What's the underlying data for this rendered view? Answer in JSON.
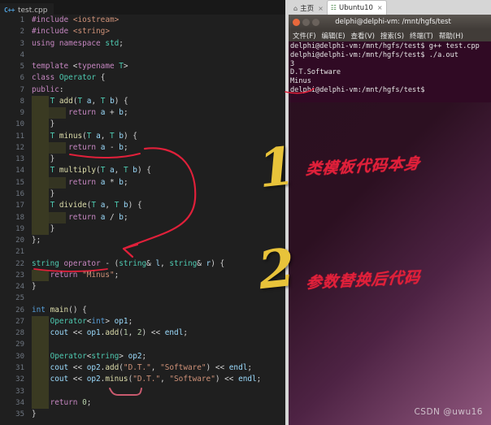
{
  "editor": {
    "tab": {
      "icon": "cpp-file-icon",
      "label": "test.cpp"
    },
    "lines": [
      {
        "n": "1",
        "indent": 0,
        "tokens": [
          {
            "t": "#include ",
            "c": "k"
          },
          {
            "t": "<iostream>",
            "c": "str"
          }
        ]
      },
      {
        "n": "2",
        "indent": 0,
        "tokens": [
          {
            "t": "#include ",
            "c": "k"
          },
          {
            "t": "<string>",
            "c": "str"
          }
        ]
      },
      {
        "n": "3",
        "indent": 0,
        "tokens": [
          {
            "t": "using",
            "c": "k"
          },
          {
            "t": " ",
            "c": "pl"
          },
          {
            "t": "namespace",
            "c": "k"
          },
          {
            "t": " ",
            "c": "pl"
          },
          {
            "t": "std",
            "c": "ty"
          },
          {
            "t": ";",
            "c": "pl"
          }
        ]
      },
      {
        "n": "4",
        "indent": 0,
        "tokens": []
      },
      {
        "n": "5",
        "indent": 0,
        "tokens": [
          {
            "t": "template",
            "c": "k"
          },
          {
            "t": " <",
            "c": "pl"
          },
          {
            "t": "typename",
            "c": "k"
          },
          {
            "t": " ",
            "c": "pl"
          },
          {
            "t": "T",
            "c": "ty"
          },
          {
            "t": ">",
            "c": "pl"
          }
        ]
      },
      {
        "n": "6",
        "indent": 0,
        "tokens": [
          {
            "t": "class",
            "c": "k"
          },
          {
            "t": " ",
            "c": "pl"
          },
          {
            "t": "Operator",
            "c": "cls"
          },
          {
            "t": " {",
            "c": "pl"
          }
        ]
      },
      {
        "n": "7",
        "indent": 0,
        "tokens": [
          {
            "t": "public",
            "c": "k"
          },
          {
            "t": ":",
            "c": "pl"
          }
        ]
      },
      {
        "n": "8",
        "indent": 1,
        "tokens": [
          {
            "t": "T",
            "c": "ty"
          },
          {
            "t": " ",
            "c": "pl"
          },
          {
            "t": "add",
            "c": "fn"
          },
          {
            "t": "(",
            "c": "pl"
          },
          {
            "t": "T",
            "c": "ty"
          },
          {
            "t": " ",
            "c": "pl"
          },
          {
            "t": "a",
            "c": "var"
          },
          {
            "t": ", ",
            "c": "pl"
          },
          {
            "t": "T",
            "c": "ty"
          },
          {
            "t": " ",
            "c": "pl"
          },
          {
            "t": "b",
            "c": "var"
          },
          {
            "t": ") {",
            "c": "pl"
          }
        ]
      },
      {
        "n": "9",
        "indent": 2,
        "tokens": [
          {
            "t": "return",
            "c": "k"
          },
          {
            "t": " ",
            "c": "pl"
          },
          {
            "t": "a",
            "c": "var"
          },
          {
            "t": " + ",
            "c": "pl"
          },
          {
            "t": "b",
            "c": "var"
          },
          {
            "t": ";",
            "c": "pl"
          }
        ]
      },
      {
        "n": "10",
        "indent": 1,
        "tokens": [
          {
            "t": "}",
            "c": "pl"
          }
        ]
      },
      {
        "n": "11",
        "indent": 1,
        "tokens": [
          {
            "t": "T",
            "c": "ty"
          },
          {
            "t": " ",
            "c": "pl"
          },
          {
            "t": "minus",
            "c": "fn"
          },
          {
            "t": "(",
            "c": "pl"
          },
          {
            "t": "T",
            "c": "ty"
          },
          {
            "t": " ",
            "c": "pl"
          },
          {
            "t": "a",
            "c": "var"
          },
          {
            "t": ", ",
            "c": "pl"
          },
          {
            "t": "T",
            "c": "ty"
          },
          {
            "t": " ",
            "c": "pl"
          },
          {
            "t": "b",
            "c": "var"
          },
          {
            "t": ") {",
            "c": "pl"
          }
        ]
      },
      {
        "n": "12",
        "indent": 2,
        "tokens": [
          {
            "t": "return",
            "c": "k"
          },
          {
            "t": " ",
            "c": "pl"
          },
          {
            "t": "a",
            "c": "var"
          },
          {
            "t": " - ",
            "c": "pl"
          },
          {
            "t": "b",
            "c": "var"
          },
          {
            "t": ";",
            "c": "pl"
          }
        ]
      },
      {
        "n": "13",
        "indent": 1,
        "tokens": [
          {
            "t": "}",
            "c": "pl"
          }
        ]
      },
      {
        "n": "14",
        "indent": 1,
        "tokens": [
          {
            "t": "T",
            "c": "ty"
          },
          {
            "t": " ",
            "c": "pl"
          },
          {
            "t": "multiply",
            "c": "fn"
          },
          {
            "t": "(",
            "c": "pl"
          },
          {
            "t": "T",
            "c": "ty"
          },
          {
            "t": " ",
            "c": "pl"
          },
          {
            "t": "a",
            "c": "var"
          },
          {
            "t": ", ",
            "c": "pl"
          },
          {
            "t": "T",
            "c": "ty"
          },
          {
            "t": " ",
            "c": "pl"
          },
          {
            "t": "b",
            "c": "var"
          },
          {
            "t": ") {",
            "c": "pl"
          }
        ]
      },
      {
        "n": "15",
        "indent": 2,
        "tokens": [
          {
            "t": "return",
            "c": "k"
          },
          {
            "t": " ",
            "c": "pl"
          },
          {
            "t": "a",
            "c": "var"
          },
          {
            "t": " * ",
            "c": "pl"
          },
          {
            "t": "b",
            "c": "var"
          },
          {
            "t": ";",
            "c": "pl"
          }
        ]
      },
      {
        "n": "16",
        "indent": 1,
        "tokens": [
          {
            "t": "}",
            "c": "pl"
          }
        ]
      },
      {
        "n": "17",
        "indent": 1,
        "tokens": [
          {
            "t": "T",
            "c": "ty"
          },
          {
            "t": " ",
            "c": "pl"
          },
          {
            "t": "divide",
            "c": "fn"
          },
          {
            "t": "(",
            "c": "pl"
          },
          {
            "t": "T",
            "c": "ty"
          },
          {
            "t": " ",
            "c": "pl"
          },
          {
            "t": "a",
            "c": "var"
          },
          {
            "t": ", ",
            "c": "pl"
          },
          {
            "t": "T",
            "c": "ty"
          },
          {
            "t": " ",
            "c": "pl"
          },
          {
            "t": "b",
            "c": "var"
          },
          {
            "t": ") {",
            "c": "pl"
          }
        ]
      },
      {
        "n": "18",
        "indent": 2,
        "tokens": [
          {
            "t": "return",
            "c": "k"
          },
          {
            "t": " ",
            "c": "pl"
          },
          {
            "t": "a",
            "c": "var"
          },
          {
            "t": " / ",
            "c": "pl"
          },
          {
            "t": "b",
            "c": "var"
          },
          {
            "t": ";",
            "c": "pl"
          }
        ]
      },
      {
        "n": "19",
        "indent": 1,
        "tokens": [
          {
            "t": "}",
            "c": "pl"
          }
        ]
      },
      {
        "n": "20",
        "indent": 0,
        "tokens": [
          {
            "t": "};",
            "c": "pl"
          }
        ]
      },
      {
        "n": "21",
        "indent": 0,
        "tokens": []
      },
      {
        "n": "22",
        "indent": 0,
        "tokens": [
          {
            "t": "string",
            "c": "ty"
          },
          {
            "t": " ",
            "c": "pl"
          },
          {
            "t": "operator",
            "c": "k"
          },
          {
            "t": " - (",
            "c": "pl"
          },
          {
            "t": "string",
            "c": "ty"
          },
          {
            "t": "& ",
            "c": "pl"
          },
          {
            "t": "l",
            "c": "var"
          },
          {
            "t": ", ",
            "c": "pl"
          },
          {
            "t": "string",
            "c": "ty"
          },
          {
            "t": "& ",
            "c": "pl"
          },
          {
            "t": "r",
            "c": "var"
          },
          {
            "t": ") {",
            "c": "pl"
          }
        ]
      },
      {
        "n": "23",
        "indent": 1,
        "tokens": [
          {
            "t": "return",
            "c": "k"
          },
          {
            "t": " ",
            "c": "pl"
          },
          {
            "t": "\"Minus\"",
            "c": "str"
          },
          {
            "t": ";",
            "c": "pl"
          }
        ]
      },
      {
        "n": "24",
        "indent": 0,
        "tokens": [
          {
            "t": "}",
            "c": "pl"
          }
        ]
      },
      {
        "n": "25",
        "indent": 0,
        "tokens": []
      },
      {
        "n": "26",
        "indent": 0,
        "tokens": [
          {
            "t": "int",
            "c": "kb"
          },
          {
            "t": " ",
            "c": "pl"
          },
          {
            "t": "main",
            "c": "fn"
          },
          {
            "t": "() {",
            "c": "pl"
          }
        ]
      },
      {
        "n": "27",
        "indent": 1,
        "tokens": [
          {
            "t": "Operator",
            "c": "cls"
          },
          {
            "t": "<",
            "c": "pl"
          },
          {
            "t": "int",
            "c": "kb"
          },
          {
            "t": "> ",
            "c": "pl"
          },
          {
            "t": "op1",
            "c": "var"
          },
          {
            "t": ";",
            "c": "pl"
          }
        ]
      },
      {
        "n": "28",
        "indent": 1,
        "tokens": [
          {
            "t": "cout",
            "c": "var"
          },
          {
            "t": " << ",
            "c": "pl"
          },
          {
            "t": "op1",
            "c": "var"
          },
          {
            "t": ".",
            "c": "pl"
          },
          {
            "t": "add",
            "c": "fn"
          },
          {
            "t": "(",
            "c": "pl"
          },
          {
            "t": "1",
            "c": "num"
          },
          {
            "t": ", ",
            "c": "pl"
          },
          {
            "t": "2",
            "c": "num"
          },
          {
            "t": ") << ",
            "c": "pl"
          },
          {
            "t": "endl",
            "c": "var"
          },
          {
            "t": ";",
            "c": "pl"
          }
        ]
      },
      {
        "n": "29",
        "indent": 1,
        "tokens": []
      },
      {
        "n": "30",
        "indent": 1,
        "tokens": [
          {
            "t": "Operator",
            "c": "cls"
          },
          {
            "t": "<",
            "c": "pl"
          },
          {
            "t": "string",
            "c": "ty"
          },
          {
            "t": "> ",
            "c": "pl"
          },
          {
            "t": "op2",
            "c": "var"
          },
          {
            "t": ";",
            "c": "pl"
          }
        ]
      },
      {
        "n": "31",
        "indent": 1,
        "tokens": [
          {
            "t": "cout",
            "c": "var"
          },
          {
            "t": " << ",
            "c": "pl"
          },
          {
            "t": "op2",
            "c": "var"
          },
          {
            "t": ".",
            "c": "pl"
          },
          {
            "t": "add",
            "c": "fn"
          },
          {
            "t": "(",
            "c": "pl"
          },
          {
            "t": "\"D.T.\"",
            "c": "str"
          },
          {
            "t": ", ",
            "c": "pl"
          },
          {
            "t": "\"Software\"",
            "c": "str"
          },
          {
            "t": ") << ",
            "c": "pl"
          },
          {
            "t": "endl",
            "c": "var"
          },
          {
            "t": ";",
            "c": "pl"
          }
        ]
      },
      {
        "n": "32",
        "indent": 1,
        "tokens": [
          {
            "t": "cout",
            "c": "var"
          },
          {
            "t": " << ",
            "c": "pl"
          },
          {
            "t": "op2",
            "c": "var"
          },
          {
            "t": ".",
            "c": "pl"
          },
          {
            "t": "minus",
            "c": "fn"
          },
          {
            "t": "(",
            "c": "pl"
          },
          {
            "t": "\"D.T.\"",
            "c": "str"
          },
          {
            "t": ", ",
            "c": "pl"
          },
          {
            "t": "\"Software\"",
            "c": "str"
          },
          {
            "t": ") << ",
            "c": "pl"
          },
          {
            "t": "endl",
            "c": "var"
          },
          {
            "t": ";",
            "c": "pl"
          }
        ]
      },
      {
        "n": "33",
        "indent": 1,
        "tokens": []
      },
      {
        "n": "34",
        "indent": 1,
        "tokens": [
          {
            "t": "return",
            "c": "k"
          },
          {
            "t": " ",
            "c": "pl"
          },
          {
            "t": "0",
            "c": "num"
          },
          {
            "t": ";",
            "c": "pl"
          }
        ]
      },
      {
        "n": "35",
        "indent": 0,
        "tokens": [
          {
            "t": "}",
            "c": "pl"
          }
        ]
      }
    ]
  },
  "browser": {
    "tabs": [
      {
        "icon": "home-icon",
        "label": "主页",
        "close": "×",
        "active": false
      },
      {
        "icon": "ubuntu-vm-icon",
        "label": "Ubuntu10",
        "close": "×",
        "active": true
      }
    ]
  },
  "terminal": {
    "title": "delphi@delphi-vm: /mnt/hgfs/test",
    "buttons": {
      "close": "close-button",
      "minimize": "minimize-button",
      "maximize": "maximize-button"
    },
    "menu": [
      "文件(F)",
      "编辑(E)",
      "查看(V)",
      "搜索(S)",
      "终端(T)",
      "帮助(H)"
    ],
    "output": "delphi@delphi-vm:/mnt/hgfs/test$ g++ test.cpp\ndelphi@delphi-vm:/mnt/hgfs/test$ ./a.out\n3\nD.T.Software\nMinus\ndelphi@delphi-vm:/mnt/hgfs/test$"
  },
  "annotations": {
    "number_one": "1",
    "number_two": "2",
    "note_one": "类模板代码本身",
    "note_two": "参数替换后代码"
  },
  "watermark": "CSDN @uwu16",
  "colors": {
    "annotation_red": "#e0203a",
    "annotation_yellow": "#e8c33a",
    "terminal_bg": "#300a24",
    "editor_bg": "#1f1f1f"
  }
}
